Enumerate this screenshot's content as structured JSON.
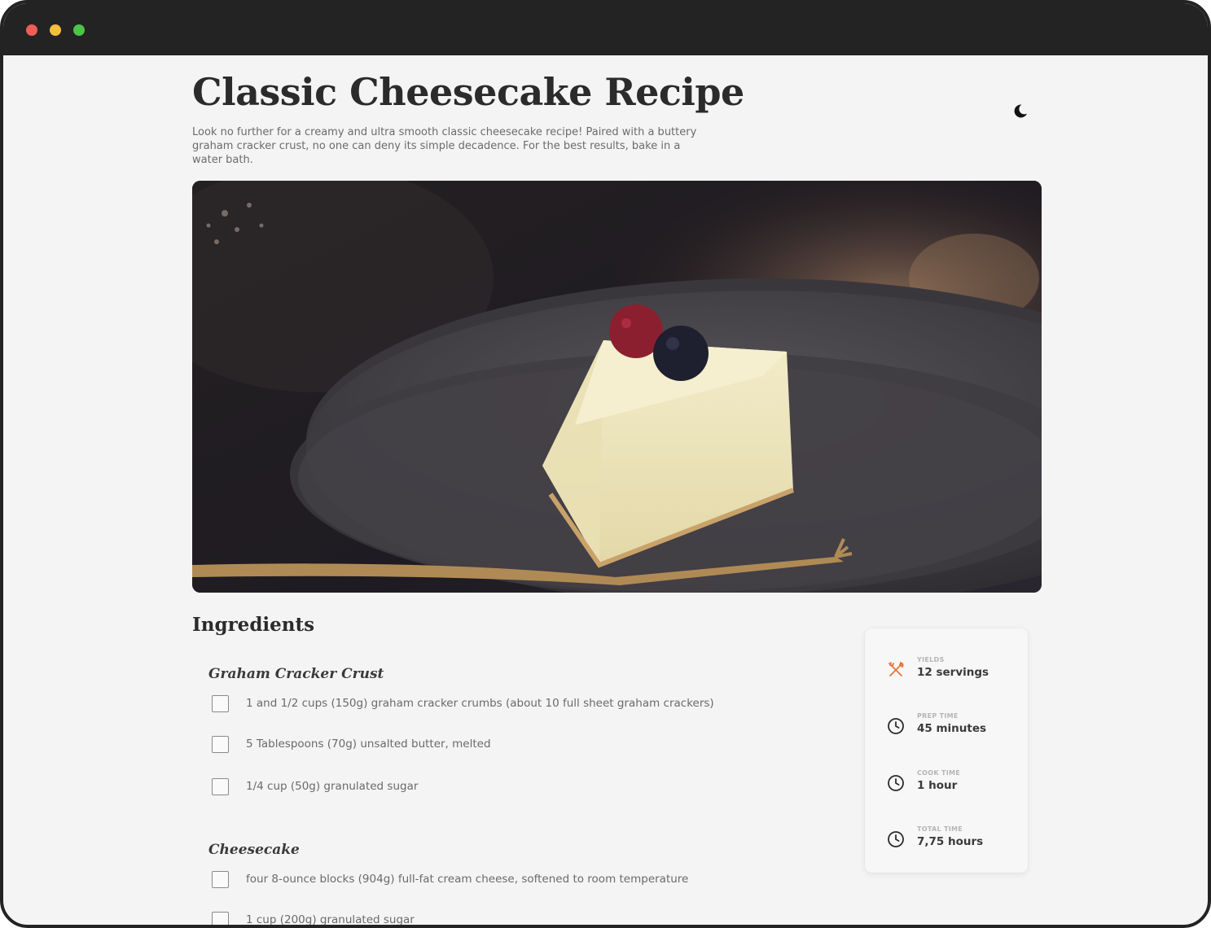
{
  "window": {
    "controls": [
      "close",
      "minimize",
      "maximize"
    ],
    "colors": {
      "close": "#ee5e57",
      "minimize": "#f5be3b",
      "maximize": "#4cc446"
    }
  },
  "header": {
    "title": "Classic Cheesecake Recipe",
    "theme_toggle_icon": "moon-icon",
    "description": "Look no further for a creamy and ultra smooth classic cheesecake recipe! Paired with a buttery graham cracker crust, no one can deny its simple decadence. For the best results, bake in a water bath."
  },
  "hero_image": {
    "subject": "cheesecake-slice-photo"
  },
  "ingredients": {
    "heading": "Ingredients",
    "sections": [
      {
        "title": "Graham Cracker Crust",
        "items": [
          {
            "text": "1 and 1/2 cups (150g) graham cracker crumbs (about 10 full sheet graham crackers)",
            "checked": false
          },
          {
            "text": "5 Tablespoons (70g) unsalted butter, melted",
            "checked": false
          },
          {
            "text": "1/4 cup (50g) granulated sugar",
            "checked": false
          }
        ]
      },
      {
        "title": "Cheesecake",
        "items": [
          {
            "text": "four 8-ounce blocks (904g) full-fat cream cheese, softened to room temperature",
            "checked": false
          },
          {
            "text": "1 cup (200g) granulated sugar",
            "checked": false
          }
        ]
      }
    ]
  },
  "info": {
    "yields": {
      "label": "YIELDS",
      "value": "12 servings",
      "icon": "utensils-icon"
    },
    "prep_time": {
      "label": "PREP TIME",
      "value": "45 minutes",
      "icon": "clock-icon"
    },
    "cook_time": {
      "label": "COOK TIME",
      "value": "1 hour",
      "icon": "clock-icon"
    },
    "total_time": {
      "label": "TOTAL TIME",
      "value": "7,75 hours",
      "icon": "clock-icon"
    },
    "accent_color": "#e8743b"
  }
}
